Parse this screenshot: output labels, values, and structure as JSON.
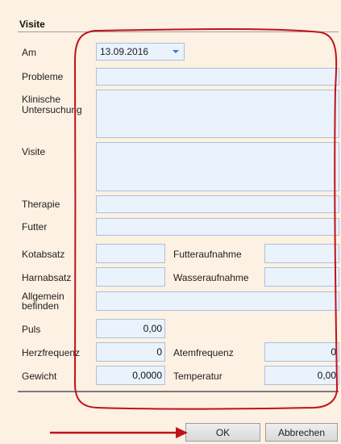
{
  "panel": {
    "title": "Visite"
  },
  "fields": {
    "am": {
      "label": "Am",
      "value": "13.09.2016"
    },
    "probleme": {
      "label": "Probleme",
      "value": ""
    },
    "klinische": {
      "label_line1": "Klinische",
      "label_line2": "Untersuchung",
      "value": ""
    },
    "visite": {
      "label": "Visite",
      "value": ""
    },
    "therapie": {
      "label": "Therapie",
      "value": ""
    },
    "futter": {
      "label": "Futter",
      "value": ""
    },
    "kotabsatz": {
      "label": "Kotabsatz",
      "value": ""
    },
    "futteraufnahme": {
      "label": "Futteraufnahme",
      "value": ""
    },
    "harnabsatz": {
      "label": "Harnabsatz",
      "value": ""
    },
    "wasseraufnahme": {
      "label": "Wasseraufnahme",
      "value": ""
    },
    "allgemein": {
      "label_line1": "Allgemein",
      "label_line2": "befinden",
      "value": ""
    },
    "puls": {
      "label": "Puls",
      "value": "0,00"
    },
    "herzfrequenz": {
      "label": "Herzfrequenz",
      "value": "0"
    },
    "atemfrequenz": {
      "label": "Atemfrequenz",
      "value": "0"
    },
    "gewicht": {
      "label": "Gewicht",
      "value": "0,0000"
    },
    "temperatur": {
      "label": "Temperatur",
      "value": "0,00"
    }
  },
  "buttons": {
    "ok": "OK",
    "cancel": "Abbrechen"
  },
  "annotation": {
    "color": "#c0121b",
    "icon": "red-arrow-icon"
  },
  "colors": {
    "background": "#fcf1e3",
    "field_fill": "#eaf2fc",
    "field_border": "#a9c1dc",
    "dropdown_arrow": "#3a78c8"
  }
}
